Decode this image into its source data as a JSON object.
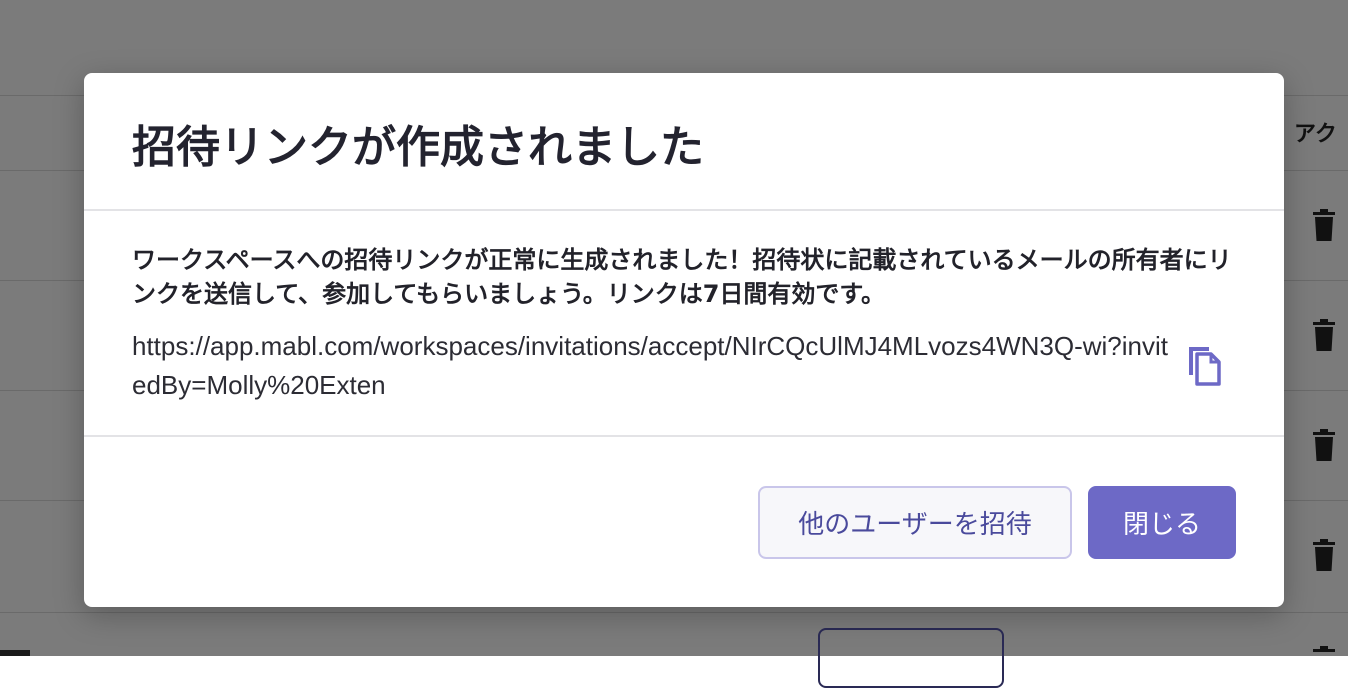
{
  "background": {
    "column_header": "アク",
    "icons": {
      "trash": "trash-icon"
    }
  },
  "modal": {
    "title": "招待リンクが作成されました",
    "message": "ワークスペースへの招待リンクが正常に生成されました！招待状に記載されているメールの所有者にリンクを送信して、参加してもらいましょう。リンクは7日間有効です。",
    "invite_link": "https://app.mabl.com/workspaces/invitations/accept/NIrCQcUlMJ4MLvozs4WN3Q-wi?invitedBy=Molly%20Exten",
    "copy_icon": "copy-icon",
    "buttons": {
      "invite_other": "他のユーザーを招待",
      "close": "閉じる"
    }
  },
  "colors": {
    "primary": "#6d69c6",
    "secondary_border": "#c9c6ea",
    "secondary_text": "#4a4a9c",
    "backdrop": "#7b7b7b"
  }
}
